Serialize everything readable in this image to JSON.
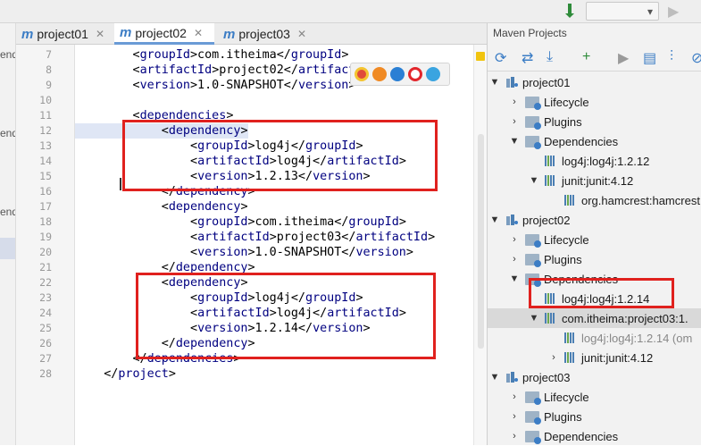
{
  "tabs": [
    {
      "label": "project01",
      "active": false
    },
    {
      "label": "project02",
      "active": true
    },
    {
      "label": "project03",
      "active": false
    }
  ],
  "left_fragments": [
    "endi",
    "endi",
    "endi"
  ],
  "code_lines": [
    {
      "n": "7",
      "text": "        <groupId>com.itheima</groupId>"
    },
    {
      "n": "8",
      "text": "        <artifactId>project02</artifactId>"
    },
    {
      "n": "9",
      "text": "        <version>1.0-SNAPSHOT</version>"
    },
    {
      "n": "10",
      "text": ""
    },
    {
      "n": "11",
      "text": "        <dependencies>"
    },
    {
      "n": "12",
      "text": "            <dependency>"
    },
    {
      "n": "13",
      "text": "                <groupId>log4j</groupId>"
    },
    {
      "n": "14",
      "text": "                <artifactId>log4j</artifactId>"
    },
    {
      "n": "15",
      "text": "                <version>1.2.13</version>"
    },
    {
      "n": "16",
      "text": "            </dependency>"
    },
    {
      "n": "17",
      "text": "            <dependency>"
    },
    {
      "n": "18",
      "text": "                <groupId>com.itheima</groupId>"
    },
    {
      "n": "19",
      "text": "                <artifactId>project03</artifactId>"
    },
    {
      "n": "20",
      "text": "                <version>1.0-SNAPSHOT</version>"
    },
    {
      "n": "21",
      "text": "            </dependency>"
    },
    {
      "n": "22",
      "text": "            <dependency>"
    },
    {
      "n": "23",
      "text": "                <groupId>log4j</groupId>"
    },
    {
      "n": "24",
      "text": "                <artifactId>log4j</artifactId>"
    },
    {
      "n": "25",
      "text": "                <version>1.2.14</version>"
    },
    {
      "n": "26",
      "text": "            </dependency>"
    },
    {
      "n": "27",
      "text": "        </dependencies>"
    },
    {
      "n": "28",
      "text": "    </project>"
    }
  ],
  "maven": {
    "title": "Maven Projects",
    "tree": [
      {
        "label": "project01",
        "icon": "maven-project-icon",
        "arrow": "▼",
        "level": 0
      },
      {
        "label": "Lifecycle",
        "icon": "folder-gear-icon",
        "arrow": "›",
        "level": 1
      },
      {
        "label": "Plugins",
        "icon": "folder-gear-icon",
        "arrow": "›",
        "level": 1
      },
      {
        "label": "Dependencies",
        "icon": "folder-gear-icon",
        "arrow": "▼",
        "level": 1
      },
      {
        "label": "log4j:log4j:1.2.12",
        "icon": "library-icon",
        "arrow": "",
        "level": 2
      },
      {
        "label": "junit:junit:4.12",
        "icon": "library-icon",
        "arrow": "▼",
        "level": 2
      },
      {
        "label": "org.hamcrest:hamcrest",
        "icon": "library-icon",
        "arrow": "",
        "level": 3
      },
      {
        "label": "project02",
        "icon": "maven-project-icon",
        "arrow": "▼",
        "level": 0
      },
      {
        "label": "Lifecycle",
        "icon": "folder-gear-icon",
        "arrow": "›",
        "level": 1
      },
      {
        "label": "Plugins",
        "icon": "folder-gear-icon",
        "arrow": "›",
        "level": 1
      },
      {
        "label": "Dependencies",
        "icon": "folder-gear-icon",
        "arrow": "▼",
        "level": 1
      },
      {
        "label": "log4j:log4j:1.2.14",
        "icon": "library-icon",
        "arrow": "",
        "level": 2
      },
      {
        "label": "com.itheima:project03:1.",
        "icon": "library-icon",
        "arrow": "▼",
        "level": 2,
        "selected": true
      },
      {
        "label": "log4j:log4j:1.2.14 (om",
        "icon": "library-icon",
        "arrow": "",
        "level": 3,
        "grey": true
      },
      {
        "label": "junit:junit:4.12",
        "icon": "library-icon",
        "arrow": "›",
        "level": 3
      },
      {
        "label": "project03",
        "icon": "maven-project-icon",
        "arrow": "▼",
        "level": 0
      },
      {
        "label": "Lifecycle",
        "icon": "folder-gear-icon",
        "arrow": "›",
        "level": 1
      },
      {
        "label": "Plugins",
        "icon": "folder-gear-icon",
        "arrow": "›",
        "level": 1
      },
      {
        "label": "Dependencies",
        "icon": "folder-gear-icon",
        "arrow": "›",
        "level": 1
      }
    ]
  },
  "colors": {
    "annotation_red": "#e0211e",
    "tag_blue": "#000080",
    "maven_blue": "#3c7dc5"
  }
}
